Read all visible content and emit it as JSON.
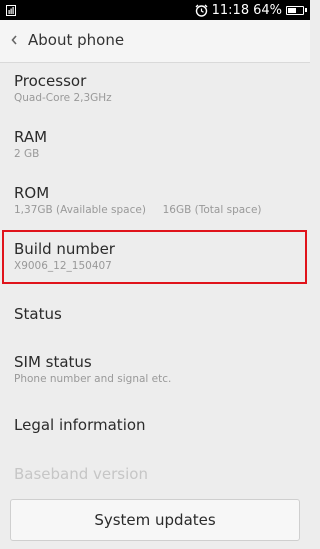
{
  "status_bar": {
    "time": "11:18",
    "battery_percent": "64%",
    "battery_level": 0.64,
    "icons": [
      "sim-icon",
      "alarm-icon",
      "battery-icon"
    ]
  },
  "header": {
    "back_icon": "chevron-left-icon",
    "title": "About phone"
  },
  "items": [
    {
      "label": "Processor",
      "sub": "Quad-Core 2,3GHz"
    },
    {
      "label": "RAM",
      "sub": "2 GB"
    },
    {
      "label": "ROM",
      "sub": "1,37GB (Available space)     16GB (Total space)"
    },
    {
      "label": "Build number",
      "sub": "X9006_12_150407"
    },
    {
      "label": "Status"
    },
    {
      "label": "SIM status",
      "sub": "Phone number and signal etc."
    },
    {
      "label": "Legal information"
    },
    {
      "label": "Baseband version"
    }
  ],
  "button": {
    "label": "System updates"
  },
  "colors": {
    "highlight": "#e0131b",
    "background": "#ededed",
    "status_bar": "#000000"
  }
}
